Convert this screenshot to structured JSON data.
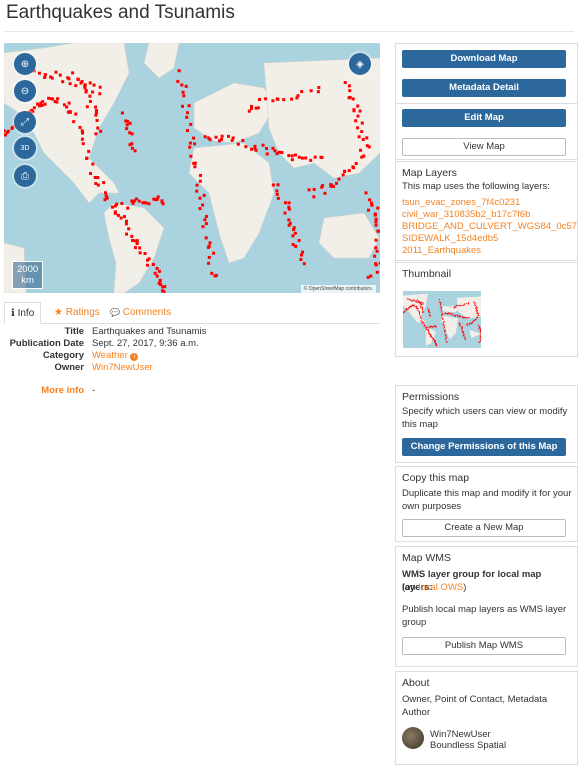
{
  "page": {
    "title": "Earthquakes and Tsunamis"
  },
  "map": {
    "controls": [
      {
        "name": "zoom-in-icon",
        "glyph": "⊕"
      },
      {
        "name": "zoom-out-icon",
        "glyph": "⊖"
      },
      {
        "name": "fullscreen-icon",
        "glyph": "⤢"
      },
      {
        "name": "3d-icon",
        "glyph": "3D"
      },
      {
        "name": "print-icon",
        "glyph": "⎙"
      }
    ],
    "layers_icon": "◈",
    "scale": {
      "value": "2000",
      "unit": "km"
    },
    "attribution": "© OpenStreetMap contributors.",
    "land_color": "#f2efe9",
    "water_color": "#aad3df",
    "point_color": "#ff0000"
  },
  "tabs": {
    "info": {
      "icon": "ℹ",
      "label": "Info"
    },
    "ratings": {
      "icon": "★",
      "label": "Ratings"
    },
    "comments": {
      "icon": "💬",
      "label": "Comments"
    }
  },
  "info": {
    "title_label": "Title",
    "title_value": "Earthquakes and Tsunamis",
    "date_label": "Publication Date",
    "date_value": "Sept. 27, 2017, 9:36 a.m.",
    "category_label": "Category",
    "category_value": "Weather",
    "owner_label": "Owner",
    "owner_value": "Win7NewUser",
    "more_label": "More info",
    "more_value": "-"
  },
  "sidebar": {
    "download": "Download Map",
    "metadata": "Metadata Detail",
    "edit": "Edit Map",
    "view": "View Map",
    "layers_title": "Map Layers",
    "layers_text": "This map uses the following layers:",
    "layers": [
      "tsun_evac_zones_7f4c0231",
      "civil_war_310835b2_b17c7f6b",
      "BRIDGE_AND_CULVERT_WGS84_0c57de1f",
      "SIDEWALK_15d4edb5",
      "2011_Earthquakes"
    ],
    "thumbnail_title": "Thumbnail",
    "permissions_title": "Permissions",
    "permissions_text": "Specify which users can view or modify this map",
    "permissions_button": "Change Permissions of this Map",
    "copy_title": "Copy this map",
    "copy_text": "Duplicate this map and modify it for your own purposes",
    "copy_button": "Create a New Map",
    "wms_title": "Map WMS",
    "wms_group_text": "WMS layer group for local map layers:",
    "wms_on_prefix": "(on ",
    "wms_on_link": "local OWS",
    "wms_on_suffix": ")",
    "wms_publish_text": "Publish local map layers as WMS layer group",
    "wms_button": "Publish Map WMS",
    "about_title": "About",
    "about_text": "Owner, Point of Contact, Metadata Author",
    "about_user": "Win7NewUser",
    "about_org": "Boundless Spatial"
  }
}
